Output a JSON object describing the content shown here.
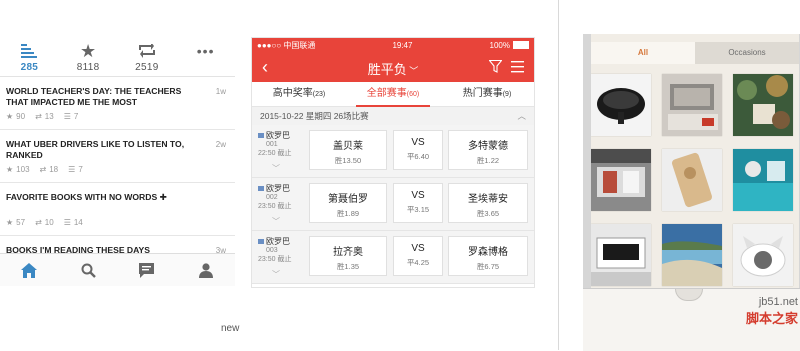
{
  "reading_app": {
    "tabs": [
      {
        "name": "list",
        "count": "285"
      },
      {
        "name": "star",
        "count": "8118"
      },
      {
        "name": "retweet",
        "count": "2519"
      },
      {
        "name": "more",
        "count": ""
      }
    ],
    "items": [
      {
        "title": "WORLD TEACHER'S DAY: THE TEACHERS THAT IMPACTED ME THE MOST",
        "age": "1w",
        "stars": "90",
        "shares": "13",
        "comments": "7"
      },
      {
        "title": "WHAT UBER DRIVERS LIKE TO LISTEN TO, RANKED",
        "age": "2w",
        "stars": "103",
        "shares": "18",
        "comments": "7"
      },
      {
        "title": "FAVORITE BOOKS WITH NO WORDS ✚",
        "age": "",
        "stars": "57",
        "shares": "10",
        "comments": "14"
      },
      {
        "title": "BOOKS I'M READING THESE DAYS",
        "age": "3w",
        "stars": "",
        "shares": "",
        "comments": ""
      }
    ]
  },
  "lottery_app": {
    "status": {
      "carrier": "●●●○○ 中国联通 ",
      "time": "19:47",
      "battery": "100%"
    },
    "nav_title": "胜平负",
    "tabs": [
      {
        "label": "高中奖率",
        "count": "(23)"
      },
      {
        "label": "全部赛事",
        "count": "(60)"
      },
      {
        "label": "热门赛事",
        "count": "(9)"
      }
    ],
    "date_line": "2015-10-22 星期四  26场比赛",
    "matches": [
      {
        "league": "欧罗巴",
        "num": "001",
        "time": "22:50 截止",
        "home": "盖贝莱",
        "home_odds": "胜13.50",
        "vs": "VS",
        "draw_odds": "平6.40",
        "away": "多特蒙德",
        "away_odds": "胜1.22"
      },
      {
        "league": "欧罗巴",
        "num": "002",
        "time": "23:50 截止",
        "home": "第聂伯罗",
        "home_odds": "胜1.89",
        "vs": "VS",
        "draw_odds": "平3.15",
        "away": "圣埃蒂安",
        "away_odds": "胜3.65"
      },
      {
        "league": "欧罗巴",
        "num": "003",
        "time": "23:50 截止",
        "home": "拉齐奥",
        "home_odds": "胜1.35",
        "vs": "VS",
        "draw_odds": "平4.25",
        "away": "罗森博格",
        "away_odds": "胜6.75"
      }
    ]
  },
  "gallery": {
    "segments": [
      "All",
      "Occasions"
    ]
  },
  "watermark": {
    "site": "jb51.net",
    "cn": "脚本之家"
  },
  "caption": "new",
  "colors": {
    "accent_blue": "#3b88c3",
    "lottery_red": "#e8443a",
    "gallery_orange": "#d5773b"
  }
}
